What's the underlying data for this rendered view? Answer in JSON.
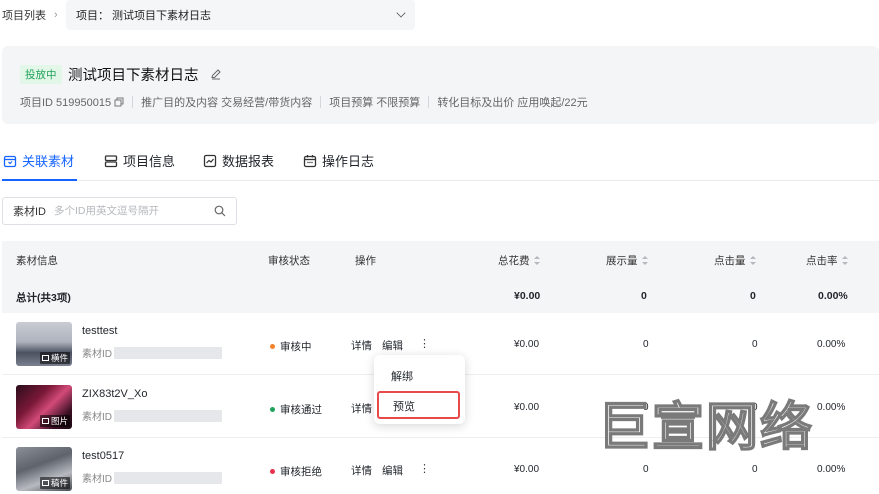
{
  "breadcrumb": {
    "root": "项目列表",
    "project_select": "项目：  测试项目下素材日志"
  },
  "project": {
    "status_badge": "投放中",
    "title": "测试项目下素材日志",
    "meta": [
      "项目ID 519950015",
      "推广目的及内容 交易经营/带货内容",
      "项目预算 不限预算",
      "转化目标及出价 应用唤起/22元"
    ]
  },
  "tabs": [
    {
      "label": "关联素材",
      "icon": "link-icon",
      "active": true
    },
    {
      "label": "项目信息",
      "icon": "info-icon",
      "active": false
    },
    {
      "label": "数据报表",
      "icon": "chart-icon",
      "active": false
    },
    {
      "label": "操作日志",
      "icon": "calendar-icon",
      "active": false
    }
  ],
  "search": {
    "label": "素材ID",
    "placeholder": "多个ID用英文逗号隔开"
  },
  "table": {
    "headers": [
      "素材信息",
      "审核状态",
      "操作",
      "总花费",
      "展示量",
      "点击量",
      "点击率"
    ],
    "total": {
      "label": "总计(共3项)",
      "cost": "¥0.00",
      "impressions": "0",
      "clicks": "0",
      "ctr": "0.00%"
    },
    "rows": [
      {
        "name": "testtest",
        "id_label": "素材ID",
        "id_value": "",
        "thumb_tag": "横件",
        "status": "审核中",
        "status_color": "#f5812b",
        "ops": [
          "详情",
          "编辑",
          "⋮"
        ],
        "cost": "¥0.00",
        "impressions": "0",
        "clicks": "0",
        "ctr": "0.00%"
      },
      {
        "name": "ZIX83t2V_Xo",
        "id_label": "素材ID",
        "id_value": "",
        "thumb_tag": "图片",
        "status": "审核通过",
        "status_color": "#1fa35a",
        "ops": [
          "详情",
          "编辑",
          "⋮"
        ],
        "cost": "¥0.00",
        "impressions": "0",
        "clicks": "0",
        "ctr": "0.00%"
      },
      {
        "name": "test0517",
        "id_label": "素材ID",
        "id_value": "",
        "thumb_tag": "稿件",
        "status": "审核拒绝",
        "status_color": "#e8324a",
        "ops": [
          "详情",
          "编辑",
          "⋮"
        ],
        "cost": "¥0.00",
        "impressions": "0",
        "clicks": "0",
        "ctr": "0.00%"
      }
    ]
  },
  "dropdown_menu": {
    "items": [
      "解绑",
      "预览"
    ],
    "highlighted": "预览"
  },
  "watermark": {
    "text": "巨宣网络"
  },
  "colors": {
    "accent": "#1664ff",
    "badge_bg": "#e3f7e9",
    "badge_text": "#1fa35a",
    "highlight_border": "#e8494a"
  }
}
